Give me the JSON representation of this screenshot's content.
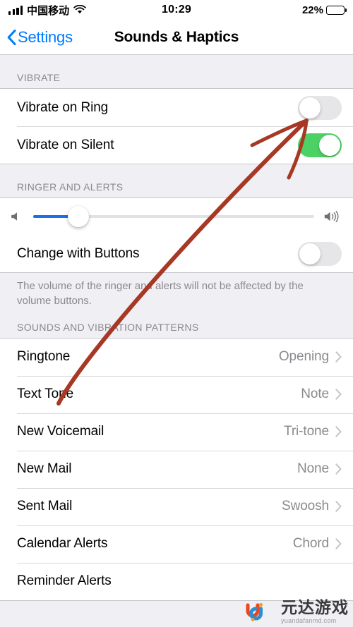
{
  "status_bar": {
    "signal_icon": "signal-bars-icon",
    "carrier": "中国移动",
    "wifi_icon": "wifi-icon",
    "time": "10:29",
    "battery_percent": "22%",
    "battery_icon": "battery-icon",
    "battery_level": 22,
    "battery_color": "#F6C33A"
  },
  "nav": {
    "back_icon": "chevron-left-icon",
    "back_label": "Settings",
    "title": "Sounds & Haptics"
  },
  "colors": {
    "accent_blue": "#007AFF",
    "toggle_on_green": "#4CD264",
    "toggle_off_gray": "#E6E6E9",
    "slider_fill_blue": "#1A6FEB",
    "annotation_red": "#A63824",
    "group_bg": "#FFFFFF",
    "page_bg": "#EFEFF4",
    "secondary_text": "#8A8A8E"
  },
  "sections": [
    {
      "header": "VIBRATE",
      "rows": [
        {
          "label": "Vibrate on Ring",
          "type": "toggle",
          "value": "off",
          "icon": "toggle-switch-icon"
        },
        {
          "label": "Vibrate on Silent",
          "type": "toggle",
          "value": "on",
          "icon": "toggle-switch-icon"
        }
      ]
    },
    {
      "header": "RINGER AND ALERTS",
      "slider": {
        "left_icon": "speaker-mute-icon",
        "right_icon": "speaker-wave-icon",
        "percent": 16
      },
      "rows": [
        {
          "label": "Change with Buttons",
          "type": "toggle",
          "value": "off",
          "icon": "toggle-switch-icon"
        }
      ],
      "footnote": "The volume of the ringer and alerts will not be affected by the volume buttons."
    },
    {
      "header": "SOUNDS AND VIBRATION PATTERNS",
      "rows": [
        {
          "label": "Ringtone",
          "type": "value",
          "value": "Opening",
          "icon": "chevron-right-icon"
        },
        {
          "label": "Text Tone",
          "type": "value",
          "value": "Note",
          "icon": "chevron-right-icon"
        },
        {
          "label": "New Voicemail",
          "type": "value",
          "value": "Tri-tone",
          "icon": "chevron-right-icon"
        },
        {
          "label": "New Mail",
          "type": "value",
          "value": "None",
          "icon": "chevron-right-icon"
        },
        {
          "label": "Sent Mail",
          "type": "value",
          "value": "Swoosh",
          "icon": "chevron-right-icon"
        },
        {
          "label": "Calendar Alerts",
          "type": "value",
          "value": "Chord",
          "icon": "chevron-right-icon"
        },
        {
          "label": "Reminder Alerts",
          "type": "value",
          "value": "",
          "icon": "chevron-right-icon"
        }
      ]
    }
  ],
  "annotation": {
    "icon": "arrow-annotation-icon",
    "color": "#A63824",
    "target": "Vibrate on Ring toggle"
  },
  "watermark": {
    "logo_icon": "yuanda-logo-icon",
    "brand": "元达游戏",
    "url": "yuandafanmd.com"
  }
}
